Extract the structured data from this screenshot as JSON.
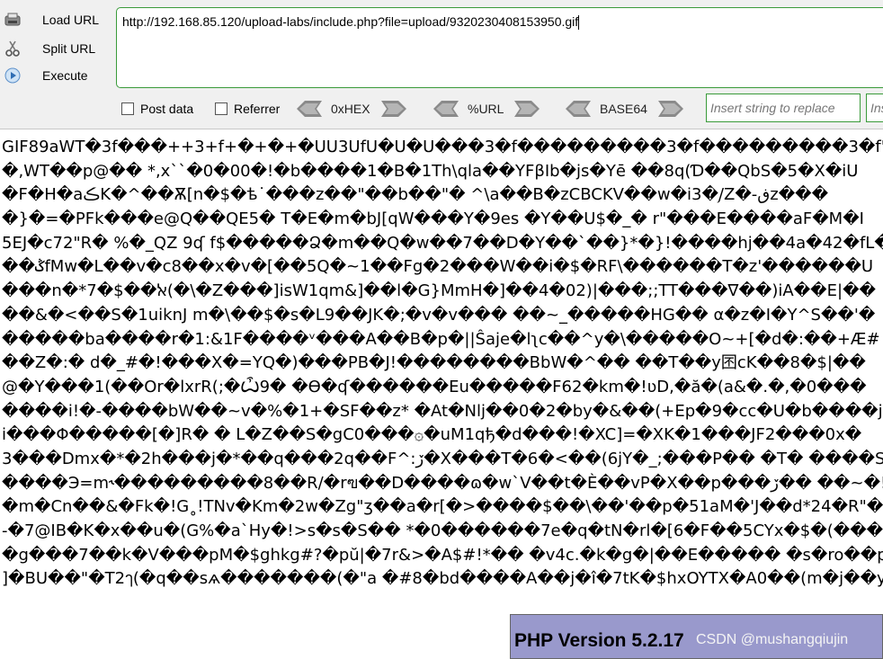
{
  "toolbar": {
    "load_url": "Load URL",
    "split_url": "Split URL",
    "execute": "Execute",
    "url_value": "http://192.168.85.120/upload-labs/include.php?file=upload/9320230408153950.gif",
    "post_data": "Post data",
    "referrer": "Referrer",
    "hex": "0xHEX",
    "url_enc": "%URL",
    "base64": "BASE64",
    "replace_placeholder": "Insert string to replace",
    "replace_with_placeholder": "Ins",
    "icons": [
      "load-url-icon",
      "split-url-icon",
      "execute-icon"
    ]
  },
  "dump_lines": [
    "GIF89aWT�3f���++3+f+�+�+�UU3UfU�U�U���3�f���������3�f���������3�f'���",
    "�,WT��p@�� *,x``�0�00�!�b����1�B�1Th\\qla��YFβIb�ϳs�Yē ��8q(Ɗ��QbS�5�X�iU",
    "�F�H�aڪK�^��Ѫ[n�$�ѣ˙���z��\"��b��\"� ^\\a��B�zCBCKV��w�i3�֥/Z�-ڧz���",
    "�}�=�PFk���e@Q��QE5� T�E�m�bJ[qW���Y�9es �Y��U$�_� r\"���E����aF�M�I",
    "5EJ�c72\"R� %�_QZ 9ʠ f$�����Ձ�m��Q�w��7��D�Y��`��}*�}!����hj��4a�42�fL�",
    "��ݣfMw�L��v�c8��x�v�[��5Q�~1��Fg�2���W��i�$�RF\\������T�z'������U",
    "���n�*7�$��ﭏ(�\\�Z���]isW1qm&]��l�G}MmH�]��4�02)|���;;TT���∇��)iA��E|��",
    "��&�<��S�1uiknJ m�\\��$�s�L9��JK�;�v�v��� ��~_�����HG�� α�z�I�Y^S��'�",
    "�����ba����r�1:&1F����ᵛ���A��B�p�||Ŝaje�lʅc��^y�\\�����O~+[�d�:��+Æ#",
    "��Z�:� d�_#�!���X�=YQ�)���PB�J!��������BbW�^�� ��T��y囨cK��8�$|��",
    "@�Y���1(��Or�lxrR(;�Ѽ9� �Ѳ�ʠ������Eu�����F62�km�!ʋD,�ă�(a&�.�,�0���",
    "����i!�-����bW��~v�%�1+�SF��z* �At�Nlj��0�2�by�&��(+Ep�9�cc�U�b����je",
    "i���Φ�����[�]R� � L�Z��S�gC0���۞�uM1qђ�d���!�XC]=�XK�1���JF2���0x�",
    "3���Dmx�*�2h���j�*��q���2q��F^:ڒ�X���T�6�<��(6jY�_;���P�� �T� ����S",
    "����Э=m˞���������8��R/�rฃ��D����ɷ�w`V��t�È��vP�X��p���ڒ�� ��~�!",
    "�m�Cn��&�Fk�!G˳!TNv�Km�2w�Zg\"ʒ��a�r[�>����$��\\��'��p�51aM�'J��d*24�R\"�",
    "-�7@IB�K�x��u�(G%�a`Hy�!>s�s�S�� *�0������7e�q�tN�rl�[6�F��5CYx�$�(���",
    "�g���7��k�V���pM�$ghkg#?�pŭ|�7r&>�A$#!*�� �v4c.�k�g�|��E����� �s�ro��p�",
    "]�BU��\"�T2ๅ(�q��sѧ�������(�\"a �#8�bd����A��j�î�7tK�$hxOYTX�A0��(m�j��y"
  ],
  "php": {
    "title": "PHP Version 5.2.17"
  },
  "watermark": "CSDN @mushangqiujin",
  "colors": {
    "url_border": "#3a9b3a",
    "php_header": "#9999cc",
    "toolbar_bg": "#f0f0f0"
  }
}
